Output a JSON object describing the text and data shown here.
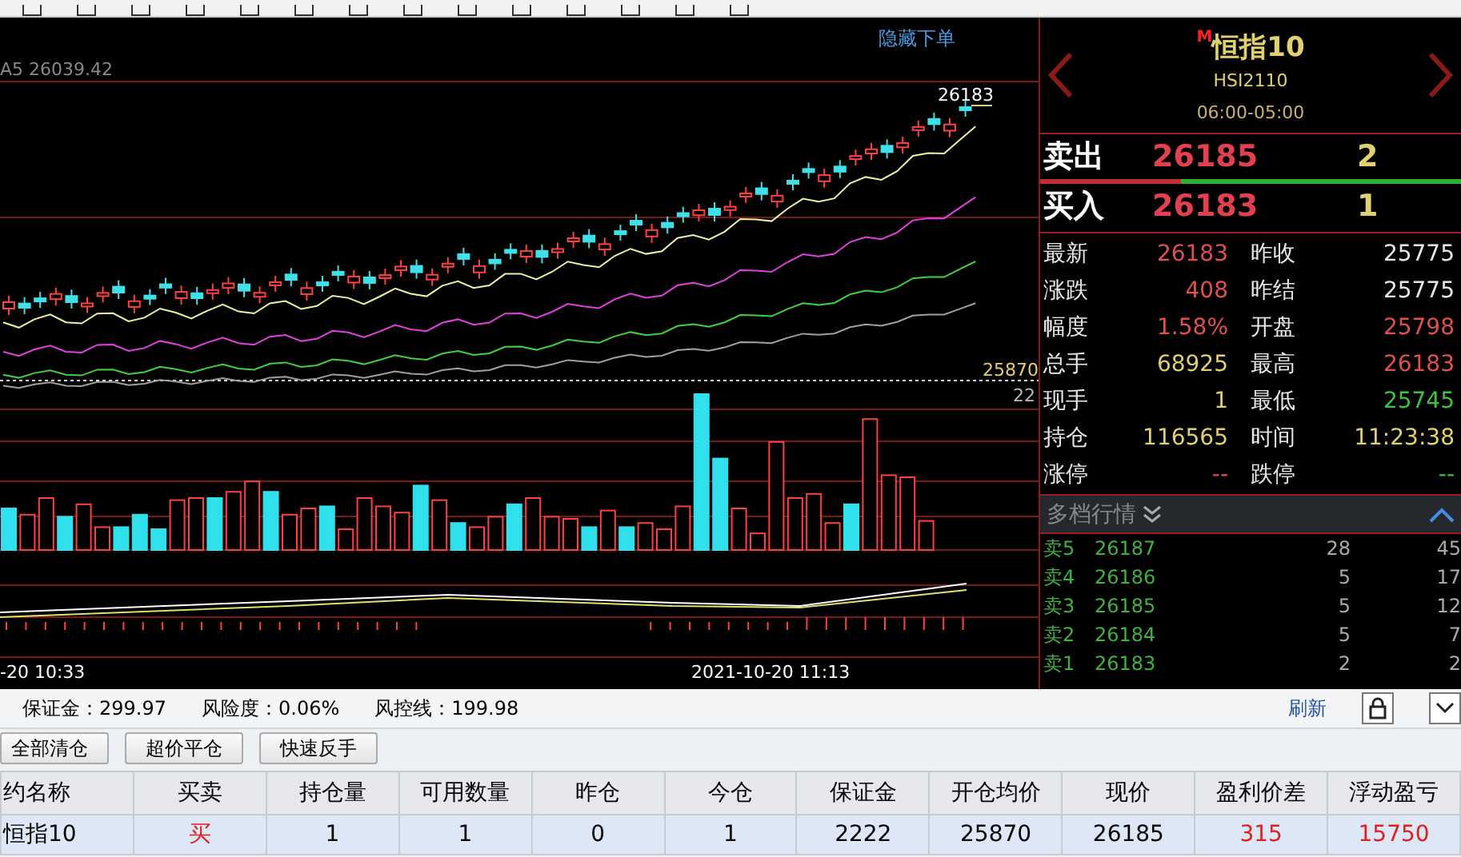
{
  "chart": {
    "hide_order_link": "隐藏下单",
    "ma_label": "A5 26039.42",
    "high_label": "26183",
    "open_price_label": "25870",
    "volume_label": "22",
    "time_labels": [
      "-20 10:33",
      "2021-10-20 11:13"
    ]
  },
  "quote": {
    "market_badge": "M",
    "name": "恒指10",
    "code": "HSI2110",
    "session": "06:00-05:00",
    "ask": {
      "label": "卖出",
      "price": "26185",
      "volume": "2"
    },
    "bid": {
      "label": "买入",
      "price": "26183",
      "volume": "1"
    },
    "stats": [
      {
        "label": "最新",
        "value": "26183",
        "color": "#e05050"
      },
      {
        "label": "昨收",
        "value": "25775",
        "color": "#e8e8e8"
      },
      {
        "label": "涨跌",
        "value": "408",
        "color": "#e05050"
      },
      {
        "label": "昨结",
        "value": "25775",
        "color": "#e8e8e8"
      },
      {
        "label": "幅度",
        "value": "1.58%",
        "color": "#e05050"
      },
      {
        "label": "开盘",
        "value": "25798",
        "color": "#e05050"
      },
      {
        "label": "总手",
        "value": "68925",
        "color": "#e0d070"
      },
      {
        "label": "最高",
        "value": "26183",
        "color": "#e05050"
      },
      {
        "label": "现手",
        "value": "1",
        "color": "#e0d070"
      },
      {
        "label": "最低",
        "value": "25745",
        "color": "#40c040"
      },
      {
        "label": "持仓",
        "value": "116565",
        "color": "#e0d070"
      },
      {
        "label": "时间",
        "value": "11:23:38",
        "color": "#e0d070"
      },
      {
        "label": "涨停",
        "value": "--",
        "color": "#e05050"
      },
      {
        "label": "跌停",
        "value": "--",
        "color": "#40c040"
      }
    ],
    "depth_title": "多档行情",
    "depth": [
      {
        "label": "卖5",
        "price": "26187",
        "volume": "28",
        "column_4": "45"
      },
      {
        "label": "卖4",
        "price": "26186",
        "volume": "5",
        "column_4": "17"
      },
      {
        "label": "卖3",
        "price": "26185",
        "volume": "5",
        "column_4": "12"
      },
      {
        "label": "卖2",
        "price": "26184",
        "volume": "5",
        "column_4": "7"
      },
      {
        "label": "卖1",
        "price": "26183",
        "volume": "2",
        "column_4": "2"
      }
    ]
  },
  "account": {
    "items": [
      "保证金：299.97",
      "风险度：0.06%",
      "风控线：199.98"
    ],
    "refresh": "刷新"
  },
  "actions": [
    "全部清仓",
    "超价平仓",
    "快速反手"
  ],
  "table": {
    "columns": [
      "约名称",
      "买卖",
      "持仓量",
      "可用数量",
      "昨仓",
      "今仓",
      "保证金",
      "开仓均价",
      "现价",
      "盈利价差",
      "浮动盈亏"
    ],
    "rows": [
      {
        "selected": true,
        "cells": [
          {
            "text": "恒指10",
            "color": "#000000"
          },
          {
            "text": "买",
            "color": "#e02020"
          },
          {
            "text": "1",
            "color": "#000000"
          },
          {
            "text": "1",
            "color": "#000000"
          },
          {
            "text": "0",
            "color": "#000000"
          },
          {
            "text": "1",
            "color": "#000000"
          },
          {
            "text": "2222",
            "color": "#000000"
          },
          {
            "text": "25870",
            "color": "#000000"
          },
          {
            "text": "26185",
            "color": "#000000"
          },
          {
            "text": "315",
            "color": "#e02020"
          },
          {
            "text": "15750",
            "color": "#e02020"
          }
        ]
      }
    ]
  }
}
